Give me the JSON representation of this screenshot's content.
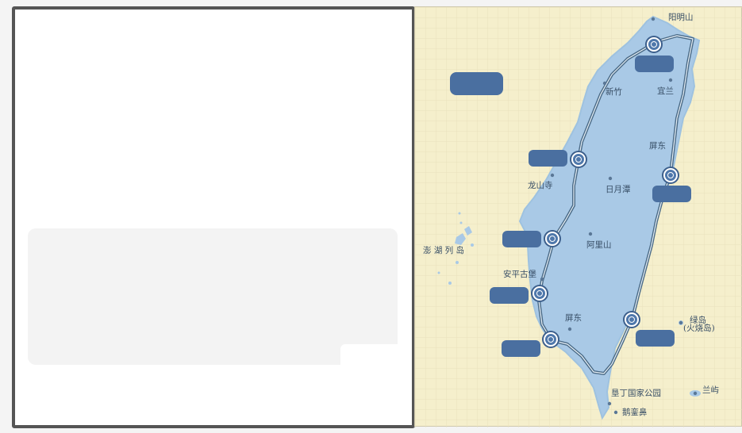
{
  "map": {
    "places": {
      "yangmingshan": "阳明山",
      "xinzhu": "新竹",
      "yilan": "宜兰",
      "pingdong_east": "屏东",
      "longshansi": "龙山寺",
      "riyuetan": "日月潭",
      "penghu": "澎 湖 列 岛",
      "alishan": "阿里山",
      "anping": "安平古堡",
      "pingdong_south": "屏东",
      "lvdao": "绿岛",
      "lvdao_alt": "(火烧岛)",
      "kenting": "垦丁国家公园",
      "lanyu": "兰屿",
      "eluanbi": "鹅銮鼻"
    },
    "route_stops_count": 8,
    "colors": {
      "background": "#f5efcc",
      "island": "#a9c9e6",
      "route": "#4a6a86",
      "badge": "#4a6fa0"
    }
  }
}
